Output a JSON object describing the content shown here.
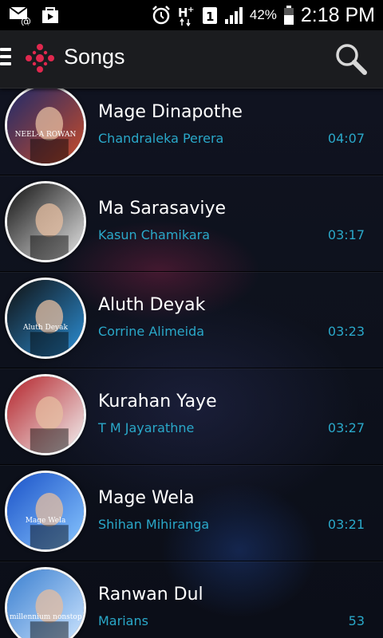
{
  "status_bar": {
    "time": "2:18 PM",
    "battery_percent": "42%",
    "network_badge": "1",
    "icons": [
      "email-icon",
      "bag-icon",
      "alarm-icon",
      "hplus-icon",
      "sim-icon",
      "signal-icon",
      "battery-icon"
    ]
  },
  "action_bar": {
    "title": "Songs",
    "icons": [
      "menu-icon",
      "app-logo-icon",
      "search-icon"
    ]
  },
  "songs": [
    {
      "title": "Mage Dinapothe",
      "artist": "Chandraleka Perera",
      "duration": "04:07"
    },
    {
      "title": "Ma Sarasaviye",
      "artist": "Kasun Chamikara",
      "duration": "03:17"
    },
    {
      "title": "Aluth Deyak",
      "artist": "Corrine Alimeida",
      "duration": "03:23"
    },
    {
      "title": "Kurahan Yaye",
      "artist": "T M Jayarathne",
      "duration": "03:27"
    },
    {
      "title": "Mage Wela",
      "artist": "Shihan Mihiranga",
      "duration": "03:21"
    },
    {
      "title": "Ranwan Dul",
      "artist": "Marians",
      "duration": "53"
    }
  ],
  "covers": [
    {
      "text": "NEEL-A ROWAN",
      "colors": [
        "#1d2a6b",
        "#c94c2a"
      ]
    },
    {
      "text": "",
      "colors": [
        "#111111",
        "#e6e6e6"
      ]
    },
    {
      "text": "Aluth Deyak",
      "colors": [
        "#101010",
        "#2c8fd6"
      ]
    },
    {
      "text": "",
      "colors": [
        "#b4232a",
        "#f2f2f2"
      ]
    },
    {
      "text": "Mage Wela",
      "colors": [
        "#1a52c8",
        "#88c6ff"
      ]
    },
    {
      "text": "millennium nonstop",
      "colors": [
        "#3a7fd0",
        "#cfe6ff"
      ]
    }
  ]
}
